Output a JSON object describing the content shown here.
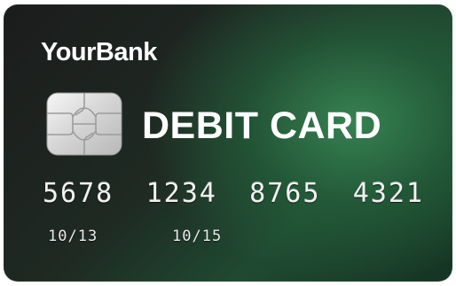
{
  "card": {
    "bank_name": "YourBank",
    "card_type": "DEBIT CARD",
    "number_groups": [
      "5678",
      "1234",
      "8765",
      "4321"
    ],
    "valid_from": "10/13",
    "expires": "10/15",
    "colors": {
      "background_dark": "#1b1c1c",
      "background_green": "#388454",
      "text": "#ffffff",
      "chip": "#d9d9d9"
    },
    "icons": {
      "chip": "emv-chip-icon"
    }
  }
}
